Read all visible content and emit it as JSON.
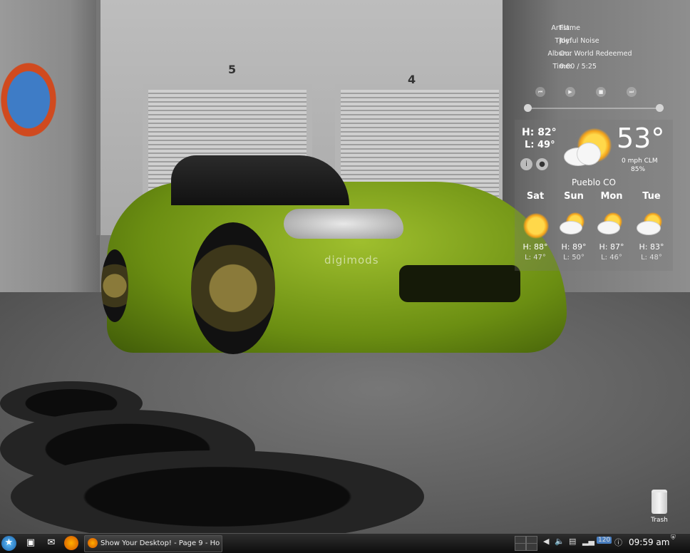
{
  "now_playing": {
    "artist_label": "Artist:",
    "artist": "Flame",
    "title_label": "Title:",
    "title": "Joyful Noise",
    "album_label": "Album:",
    "album": "Our World Redeemed",
    "time_label": "Time:",
    "time": "0:00 / 5:25",
    "controls": [
      "previous-icon",
      "play-icon",
      "stop-icon",
      "next-icon"
    ]
  },
  "weather": {
    "high": "H: 82°",
    "low": "L: 49°",
    "current_temp": "53°",
    "wind": "0 mph CLM",
    "humidity": "85%",
    "location": "Pueblo CO",
    "condition_icon": "partly-sunny-icon",
    "forecast": [
      {
        "day": "Sat",
        "high": "H: 88°",
        "low": "L: 47°",
        "icon": "sunny-icon"
      },
      {
        "day": "Sun",
        "high": "H: 89°",
        "low": "L: 50°",
        "icon": "partly-cloudy-icon"
      },
      {
        "day": "Mon",
        "high": "H: 87°",
        "low": "L: 46°",
        "icon": "partly-cloudy-icon"
      },
      {
        "day": "Tue",
        "high": "H: 83°",
        "low": "L: 48°",
        "icon": "partly-cloudy-icon"
      }
    ]
  },
  "wallpaper": {
    "door_left": "5",
    "door_right": "4",
    "car_text": "digimods"
  },
  "desktop": {
    "trash_label": "Trash"
  },
  "taskbar": {
    "task_title": "Show Your Desktop! - Page 9 - Ho",
    "clock": "09:59 am",
    "tray_badge": "120",
    "launchers": [
      "kde-menu-icon",
      "desktop-icon",
      "mail-icon",
      "firefox-icon"
    ]
  },
  "colors": {
    "taskbar": "#1a1a1a",
    "car_green": "#7fa51d",
    "sun": "#f3a21a"
  }
}
